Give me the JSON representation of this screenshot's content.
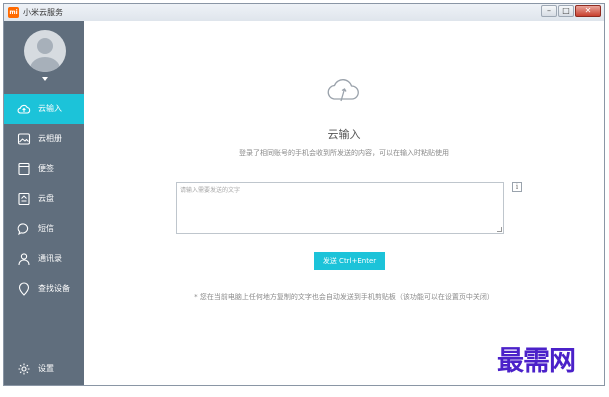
{
  "window": {
    "title": "小米云服务",
    "logo_text": "mi",
    "controls": {
      "minimize": "–",
      "maximize": "□",
      "close": "✕"
    }
  },
  "sidebar": {
    "items": [
      {
        "label": "云输入",
        "icon": "cloud-upload-icon",
        "active": true
      },
      {
        "label": "云相册",
        "icon": "photo-icon",
        "active": false
      },
      {
        "label": "便签",
        "icon": "notes-icon",
        "active": false
      },
      {
        "label": "云盘",
        "icon": "cloud-drive-icon",
        "active": false
      },
      {
        "label": "短信",
        "icon": "message-icon",
        "active": false
      },
      {
        "label": "通讯录",
        "icon": "contacts-icon",
        "active": false
      },
      {
        "label": "查找设备",
        "icon": "find-device-icon",
        "active": false
      }
    ],
    "settings_label": "设置"
  },
  "main": {
    "title": "云输入",
    "description": "登录了相同账号的手机会收到所发送的内容，可以在输入时粘贴使用",
    "input": {
      "placeholder": "请输入需要发送的文字",
      "value": ""
    },
    "info_label": "i",
    "send_button": "发送 Ctrl+Enter",
    "footnote": "* 您在当前电脑上任何地方复制的文字也会自动发送到手机剪贴板（该功能可以在设置页中关闭）"
  },
  "watermark": "最需网",
  "colors": {
    "accent": "#1cc3d9",
    "sidebar": "#606e7d",
    "watermark": "#4b21c9"
  }
}
